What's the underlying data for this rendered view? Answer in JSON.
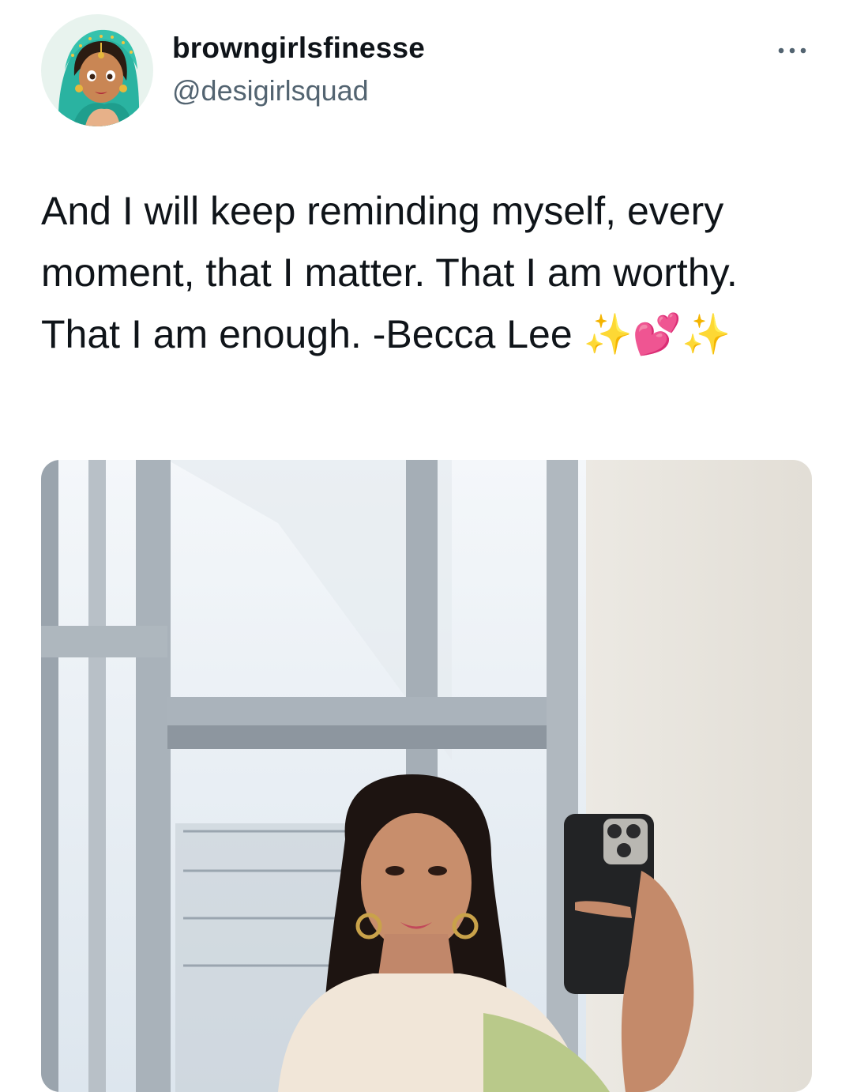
{
  "tweet": {
    "author": {
      "display_name": "browngirlsfinesse",
      "handle": "@desigirlsquad",
      "avatar_icon": "cartoon-woman-teal-dupatta-avatar"
    },
    "more_icon": "more-horizontal-icon",
    "text": "And I will keep reminding myself, every moment, that I matter. That I am worthy. That I am enough. -Becca Lee ✨💕✨",
    "media": {
      "kind": "photo",
      "subject": "mirror-selfie-photo"
    }
  },
  "colors": {
    "text_primary": "#0f1419",
    "text_secondary": "#536471",
    "avatar_bg": "#e8f3ee",
    "dupatta": "#2ab3a1"
  }
}
